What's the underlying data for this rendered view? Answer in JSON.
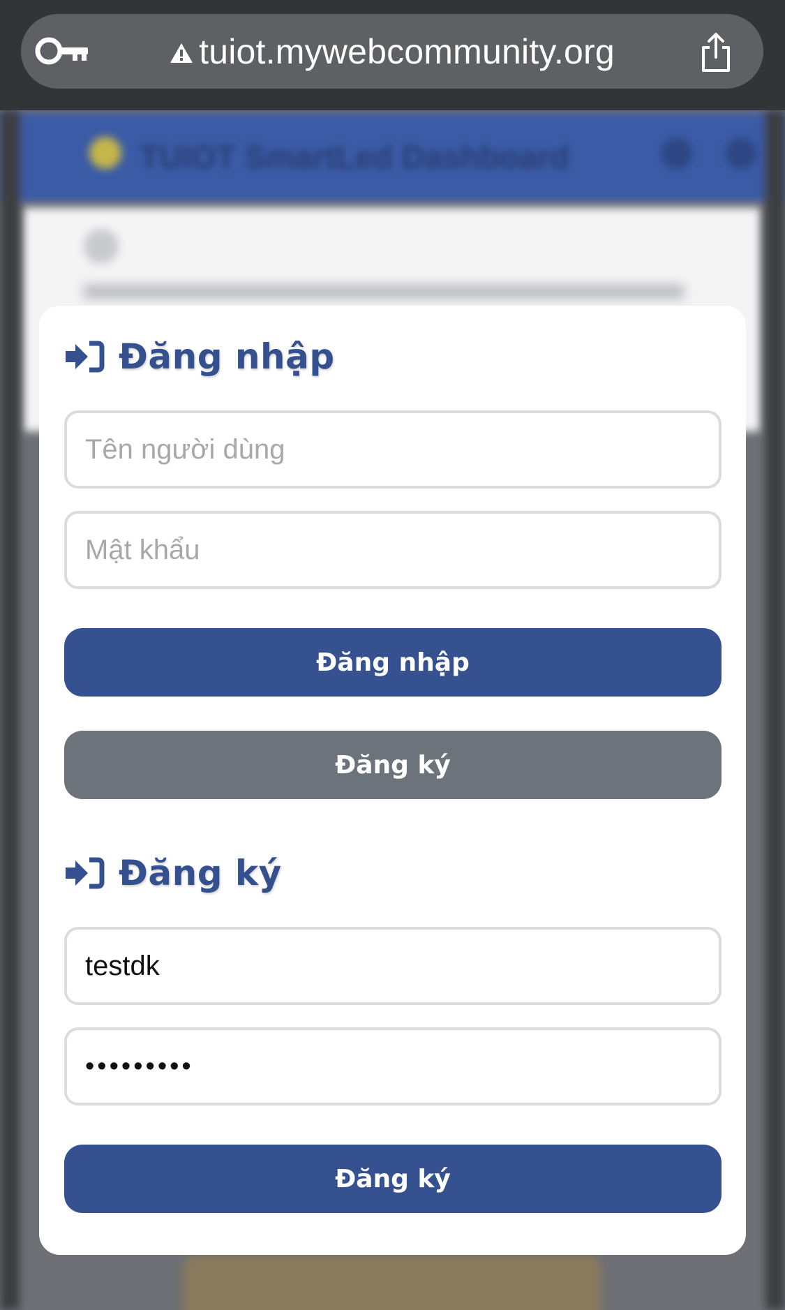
{
  "browser": {
    "url": "tuiot.mywebcommunity.org"
  },
  "background": {
    "header_title": "TUIOT SmartLed Dashboard"
  },
  "login": {
    "title": "Đăng nhập",
    "username_placeholder": "Tên người dùng",
    "username_value": "",
    "password_placeholder": "Mật khẩu",
    "password_value": "",
    "submit_label": "Đăng nhập",
    "switch_label": "Đăng ký"
  },
  "register": {
    "title": "Đăng ký",
    "username_placeholder": "",
    "username_value": "testdk",
    "password_placeholder": "",
    "password_value": "123456789",
    "submit_label": "Đăng ký"
  },
  "colors": {
    "accent": "#36518f",
    "secondary_button": "#6d737b",
    "url_bar": "#5f6064",
    "top_bar": "#333437"
  },
  "icons": {
    "browser_key": "key-icon",
    "browser_warning": "warning-icon",
    "browser_share": "share-icon",
    "login_title": "sign-in-icon",
    "register_title": "sign-in-icon"
  }
}
